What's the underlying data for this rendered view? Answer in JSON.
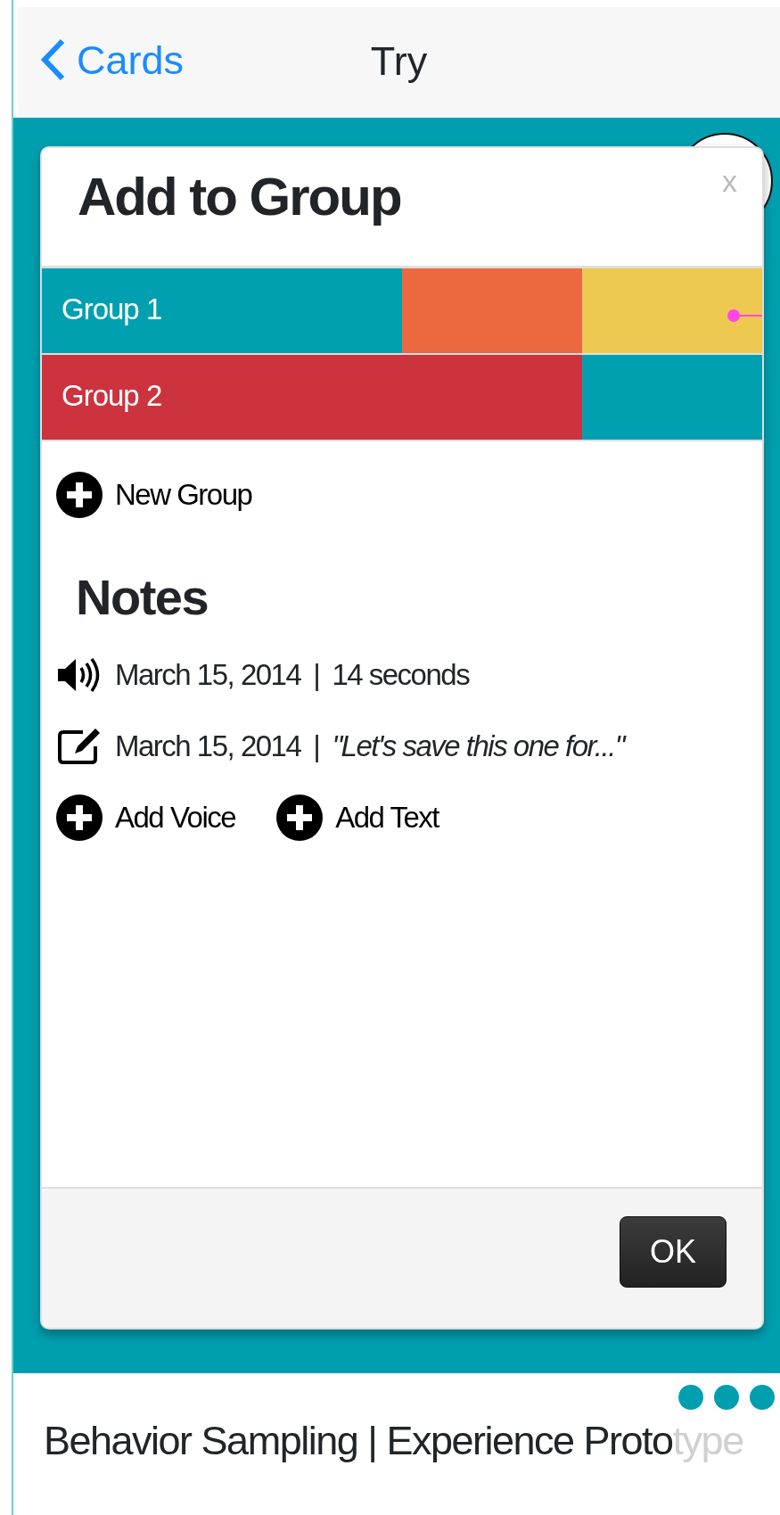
{
  "nav": {
    "back": "Cards",
    "title": "Try"
  },
  "dialog": {
    "title": "Add to Group",
    "close": "x",
    "groups": [
      {
        "label": "Group 1",
        "segments": [
          {
            "color": "#00a0b0"
          },
          {
            "color": "#00a0b0"
          },
          {
            "color": "#eb6841"
          },
          {
            "color": "#edc951"
          }
        ]
      },
      {
        "label": "Group 2",
        "segments": [
          {
            "color": "#cc333f"
          },
          {
            "color": "#cc333f"
          },
          {
            "color": "#cc333f"
          },
          {
            "color": "#00a0b0"
          }
        ]
      }
    ],
    "new_group": "New Group",
    "notes_title": "Notes",
    "notes": [
      {
        "kind": "voice",
        "date": "March 15, 2014",
        "separator": "|",
        "detail": "14 seconds"
      },
      {
        "kind": "text",
        "date": "March 15, 2014",
        "separator": "|",
        "detail": "\"Let's save this one for...\""
      }
    ],
    "add_actions": [
      "Add Voice",
      "Add Text"
    ],
    "ok": "OK"
  },
  "footer": {
    "tagline": "Behavior Sampling | Experience Proto",
    "tagline_faded": "type"
  }
}
